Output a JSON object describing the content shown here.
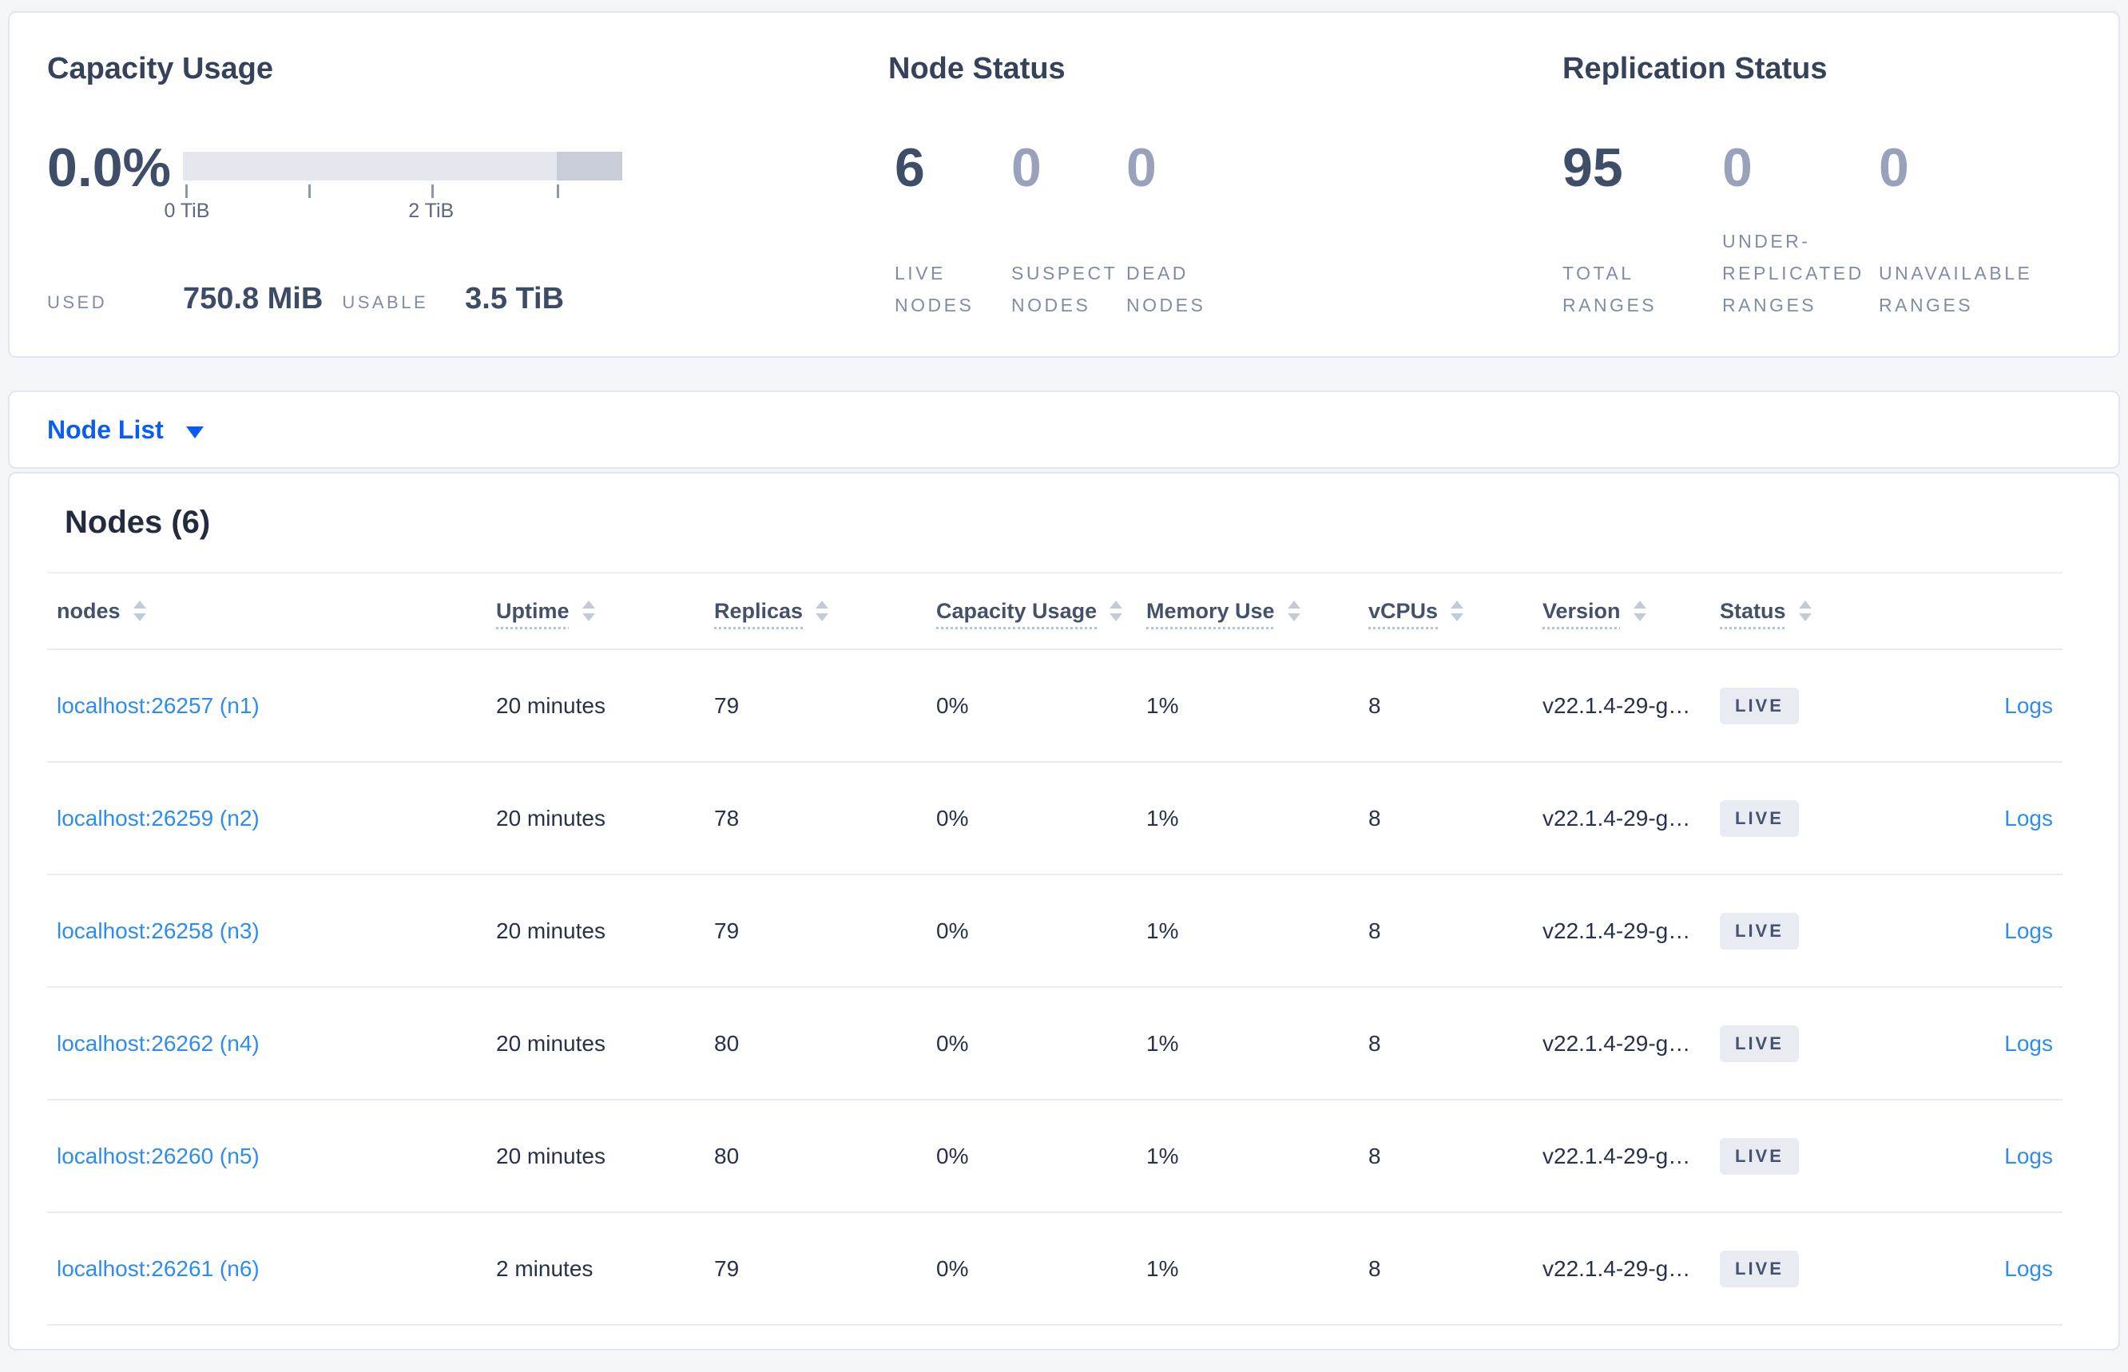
{
  "summary": {
    "capacity": {
      "title": "Capacity Usage",
      "percent": "0.0%",
      "axis_tick_labels": [
        "0 TiB",
        "2 TiB"
      ],
      "used_label": "USED",
      "used_value": "750.8 MiB",
      "usable_label": "USABLE",
      "usable_value": "3.5 TiB"
    },
    "node_status": {
      "title": "Node Status",
      "stats": [
        {
          "value": "6",
          "label": "LIVE NODES"
        },
        {
          "value": "0",
          "label": "SUSPECT NODES"
        },
        {
          "value": "0",
          "label": "DEAD NODES"
        }
      ]
    },
    "replication": {
      "title": "Replication Status",
      "stats": [
        {
          "value": "95",
          "label": "TOTAL RANGES"
        },
        {
          "value": "0",
          "label": "UNDER-REPLICATED RANGES"
        },
        {
          "value": "0",
          "label": "UNAVAILABLE RANGES"
        }
      ]
    }
  },
  "node_list": {
    "label": "Node List"
  },
  "nodes_table": {
    "title": "Nodes (6)",
    "columns": [
      {
        "label": "nodes"
      },
      {
        "label": "Uptime"
      },
      {
        "label": "Replicas"
      },
      {
        "label": "Capacity Usage"
      },
      {
        "label": "Memory Use"
      },
      {
        "label": "vCPUs"
      },
      {
        "label": "Version"
      },
      {
        "label": "Status"
      }
    ],
    "rows": [
      {
        "address": "localhost:26257 (n1)",
        "uptime": "20 minutes",
        "replicas": "79",
        "capacity_usage": "0%",
        "memory_use": "1%",
        "vcpus": "8",
        "version": "v22.1.4-29-g…",
        "status": "LIVE",
        "logs": "Logs"
      },
      {
        "address": "localhost:26259 (n2)",
        "uptime": "20 minutes",
        "replicas": "78",
        "capacity_usage": "0%",
        "memory_use": "1%",
        "vcpus": "8",
        "version": "v22.1.4-29-g…",
        "status": "LIVE",
        "logs": "Logs"
      },
      {
        "address": "localhost:26258 (n3)",
        "uptime": "20 minutes",
        "replicas": "79",
        "capacity_usage": "0%",
        "memory_use": "1%",
        "vcpus": "8",
        "version": "v22.1.4-29-g…",
        "status": "LIVE",
        "logs": "Logs"
      },
      {
        "address": "localhost:26262 (n4)",
        "uptime": "20 minutes",
        "replicas": "80",
        "capacity_usage": "0%",
        "memory_use": "1%",
        "vcpus": "8",
        "version": "v22.1.4-29-g…",
        "status": "LIVE",
        "logs": "Logs"
      },
      {
        "address": "localhost:26260 (n5)",
        "uptime": "20 minutes",
        "replicas": "80",
        "capacity_usage": "0%",
        "memory_use": "1%",
        "vcpus": "8",
        "version": "v22.1.4-29-g…",
        "status": "LIVE",
        "logs": "Logs"
      },
      {
        "address": "localhost:26261 (n6)",
        "uptime": "2 minutes",
        "replicas": "79",
        "capacity_usage": "0%",
        "memory_use": "1%",
        "vcpus": "8",
        "version": "v22.1.4-29-g…",
        "status": "LIVE",
        "logs": "Logs"
      }
    ]
  },
  "colors": {
    "page_background": "#f3f5f9",
    "card_border": "#e3e6ee",
    "primary_stat": "#3e4e68",
    "muted_stat": "#98a2ba",
    "label_gray": "#808ca6",
    "bar_track": "#e5e7ee",
    "bar_segment": "#c9cdd9",
    "dropdown_blue": "#0a5cf5",
    "link_blue": "#2e8cf0",
    "badge_background": "#e8ebf2",
    "badge_text": "#45536e"
  }
}
